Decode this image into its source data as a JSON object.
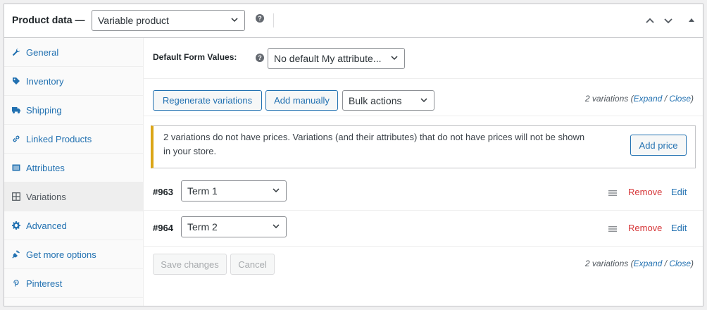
{
  "header": {
    "title": "Product data —",
    "product_type": "Variable product",
    "help": "?"
  },
  "sidebar": {
    "items": [
      {
        "label": "General",
        "icon": "wrench-icon"
      },
      {
        "label": "Inventory",
        "icon": "tag-icon"
      },
      {
        "label": "Shipping",
        "icon": "truck-icon"
      },
      {
        "label": "Linked Products",
        "icon": "link-icon"
      },
      {
        "label": "Attributes",
        "icon": "list-icon"
      },
      {
        "label": "Variations",
        "icon": "grid-icon",
        "active": true
      },
      {
        "label": "Advanced",
        "icon": "gear-icon"
      },
      {
        "label": "Get more options",
        "icon": "plugin-icon"
      },
      {
        "label": "Pinterest",
        "icon": "pinterest-icon"
      }
    ]
  },
  "variations_panel": {
    "default_form_label": "Default Form Values:",
    "default_form_value": "No default My attribute...",
    "regenerate_label": "Regenerate variations",
    "add_manually_label": "Add manually",
    "bulk_actions_label": "Bulk actions",
    "count_prefix": "2 variations (",
    "expand_label": "Expand",
    "count_sep": " / ",
    "close_label": "Close",
    "count_suffix": ")",
    "notice_text": "2 variations do not have prices. Variations (and their attributes) that do not have prices will not be shown in your store.",
    "add_price_label": "Add price",
    "variations": [
      {
        "id": "#963",
        "term": "Term 1"
      },
      {
        "id": "#964",
        "term": "Term 2"
      }
    ],
    "remove_label": "Remove",
    "edit_label": "Edit",
    "save_label": "Save changes",
    "cancel_label": "Cancel"
  },
  "colors": {
    "link": "#2271b1",
    "remove": "#d63638",
    "notice_accent": "#dba617"
  }
}
